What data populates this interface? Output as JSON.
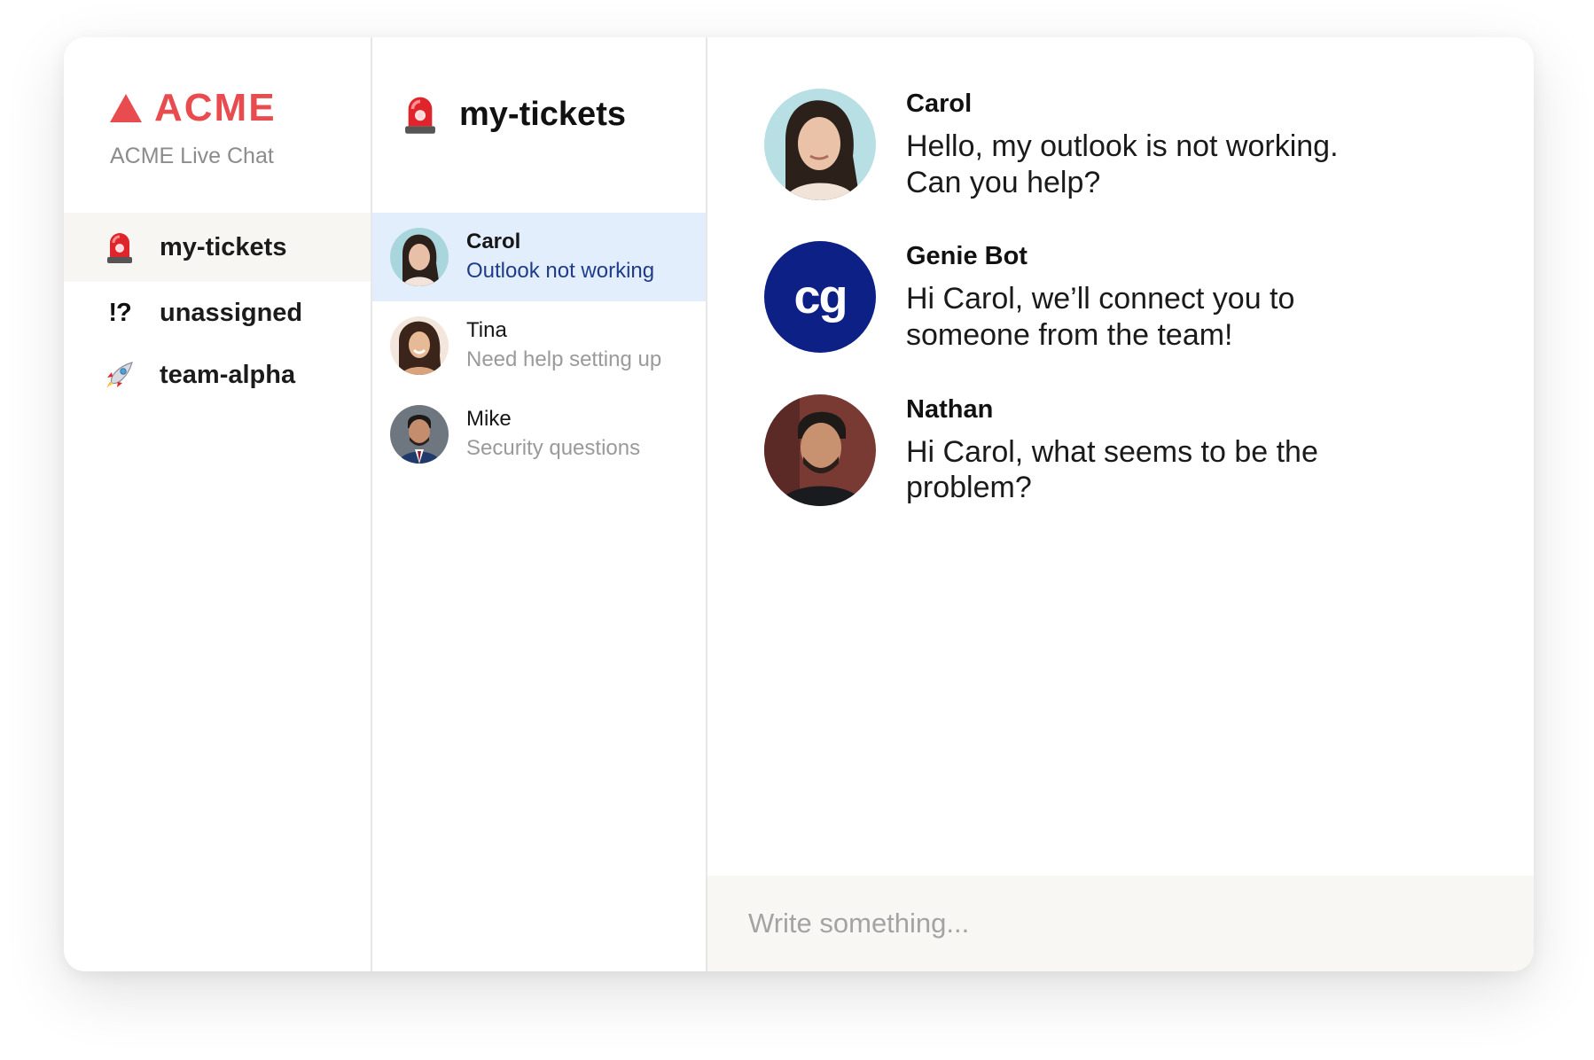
{
  "brand": {
    "name": "ACME",
    "subtitle": "ACME Live Chat",
    "color": "#e84c4f"
  },
  "sidebar": {
    "items": [
      {
        "label": "my-tickets",
        "icon": "siren-icon",
        "active": true
      },
      {
        "label": "unassigned",
        "icon": "interrobang-icon",
        "icon_text": "!?",
        "active": false
      },
      {
        "label": "team-alpha",
        "icon": "rocket-icon",
        "active": false
      }
    ]
  },
  "tickets": {
    "title": "my-tickets",
    "icon": "siren-icon",
    "items": [
      {
        "name": "Carol",
        "subject": "Outlook not working",
        "active": true
      },
      {
        "name": "Tina",
        "subject": "Need help setting up",
        "active": false
      },
      {
        "name": "Mike",
        "subject": "Security questions",
        "active": false
      }
    ]
  },
  "conversation": {
    "messages": [
      {
        "author": "Carol",
        "text": "Hello, my outlook is not working. Can you help?"
      },
      {
        "author": "Genie Bot",
        "avatar_text": "cg",
        "text": "Hi Carol, we’ll connect you to someone from the team!"
      },
      {
        "author": "Nathan",
        "text": "Hi Carol, what seems to be the problem?"
      }
    ],
    "composer": {
      "placeholder": "Write something...",
      "value": ""
    }
  },
  "colors": {
    "accent": "#e84c4f",
    "active_ticket_bg": "#e3eefd",
    "active_ticket_subject": "#1f3c88",
    "bot_avatar": "#0d2085",
    "composer_bg": "#f8f7f4"
  }
}
